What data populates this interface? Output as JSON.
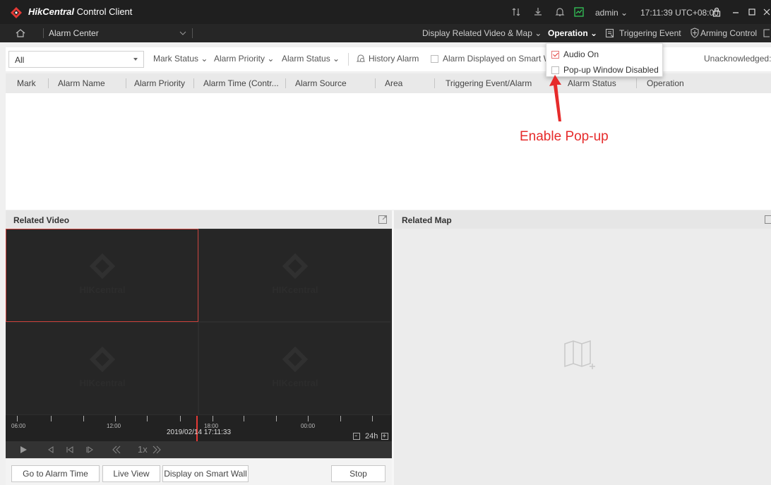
{
  "titlebar": {
    "app_name_bold": "HikCentral",
    "app_name_rest": " Control Client",
    "user": "admin",
    "clock": "17:11:39 UTC+08:00"
  },
  "navbar": {
    "module": "Alarm Center",
    "items": [
      {
        "label": "Display Related Video & Map"
      },
      {
        "label": "Operation"
      },
      {
        "label": "Triggering Event"
      },
      {
        "label": "Arming Control"
      }
    ]
  },
  "filterbar": {
    "select_value": "All",
    "mark_status": "Mark Status",
    "alarm_priority": "Alarm Priority",
    "alarm_status": "Alarm Status",
    "history_alarm": "History Alarm",
    "smart_wall": "Alarm Displayed on Smart Wa",
    "unacknowledged": "Unacknowledged:"
  },
  "table": {
    "columns": [
      "Mark",
      "Alarm Name",
      "Alarm Priority",
      "Alarm Time (Contr...",
      "Alarm Source",
      "Area",
      "Triggering Event/Alarm",
      "Alarm Status",
      "Operation"
    ]
  },
  "dropdown": {
    "items": [
      {
        "label": "Audio On",
        "checked": true
      },
      {
        "label": "Pop-up Window Disabled",
        "checked": false
      }
    ]
  },
  "annotation": {
    "text": "Enable Pop-up",
    "color": "#e62b2b"
  },
  "video_panel": {
    "title": "Related Video",
    "watermark": "HIKcentral",
    "timeline": {
      "ticks": [
        "06:00",
        "12:00",
        "18:00",
        "00:00"
      ],
      "date": "2019/02/14 17:11:33",
      "zoom": "24h"
    },
    "speed": "1x",
    "buttons": {
      "go_to_alarm_time": "Go to Alarm Time",
      "live_view": "Live View",
      "display_on_smart_wall": "Display on Smart Wall",
      "stop": "Stop"
    }
  },
  "map_panel": {
    "title": "Related Map"
  },
  "colors": {
    "accent_red": "#e53935",
    "titlebar_bg": "#1f1f1f",
    "video_bg": "#1a1a1a"
  }
}
